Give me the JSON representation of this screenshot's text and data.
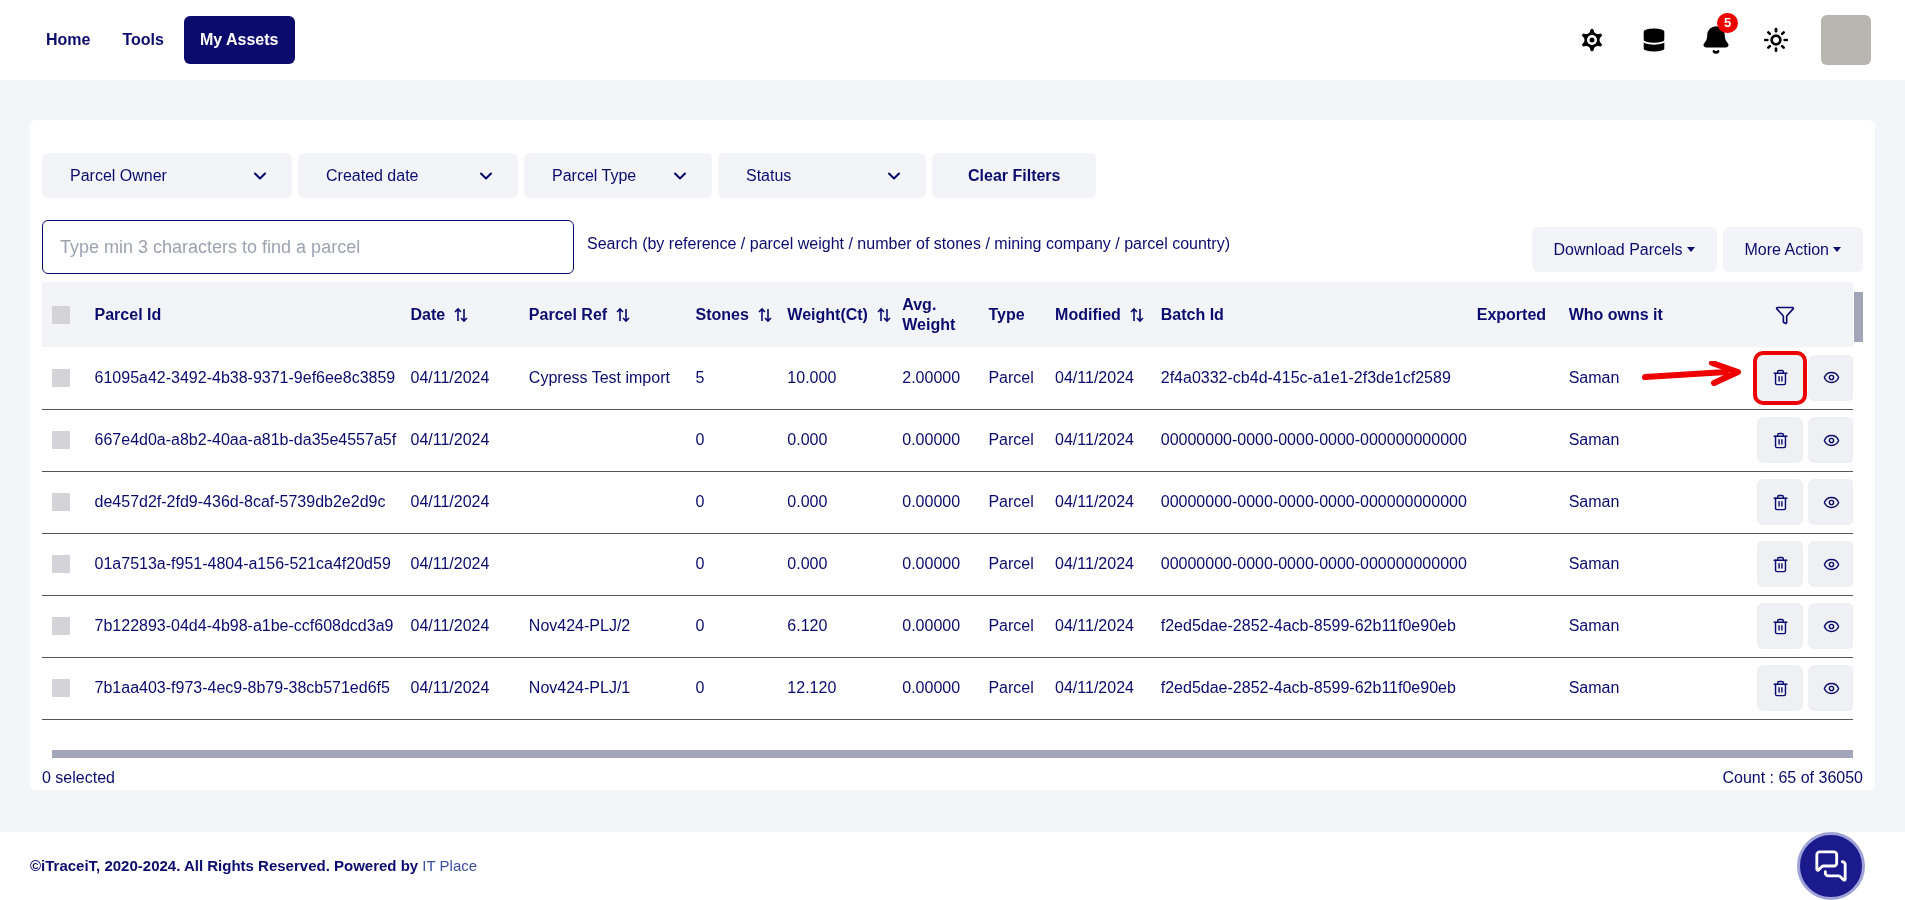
{
  "nav": {
    "tabs": [
      {
        "label": "Home",
        "selected": false
      },
      {
        "label": "Tools",
        "selected": false
      },
      {
        "label": "My Assets",
        "selected": true
      }
    ],
    "notification_count": "5"
  },
  "filters": [
    "Parcel Owner",
    "Created date",
    "Parcel Type",
    "Status"
  ],
  "clear_filters": "Clear Filters",
  "search": {
    "placeholder": "Type min 3 characters to find a parcel",
    "hint": "Search (by reference / parcel weight / number of stones / mining company / parcel country)"
  },
  "actions": [
    "Download Parcels",
    "More Action"
  ],
  "table": {
    "select_all_checked": false,
    "columns": [
      {
        "label": "Parcel Id",
        "sortable": false
      },
      {
        "label": "Date",
        "sortable": true
      },
      {
        "label": "Parcel Ref",
        "sortable": true
      },
      {
        "label": "Stones",
        "sortable": true
      },
      {
        "label": "Weight(Ct)",
        "sortable": true
      },
      {
        "label": "Avg. Weight",
        "sortable": false
      },
      {
        "label": "Type",
        "sortable": false
      },
      {
        "label": "Modified",
        "sortable": true
      },
      {
        "label": "Batch Id",
        "sortable": false
      },
      {
        "label": "Exported",
        "sortable": false
      },
      {
        "label": "Who owns it",
        "sortable": false
      }
    ],
    "rows": [
      {
        "checked": false,
        "annotated": true,
        "cells": [
          "61095a42-3492-4b38-9371-9ef6ee8c3859",
          "04/11/2024",
          "Cypress Test import",
          "5",
          "10.000",
          "2.00000",
          "Parcel",
          "04/11/2024",
          "2f4a0332-cb4d-415c-a1e1-2f3de1cf2589",
          "",
          "Saman"
        ]
      },
      {
        "checked": false,
        "annotated": false,
        "cells": [
          "667e4d0a-a8b2-40aa-a81b-da35e4557a5f",
          "04/11/2024",
          "",
          "0",
          "0.000",
          "0.00000",
          "Parcel",
          "04/11/2024",
          "00000000-0000-0000-0000-000000000000",
          "",
          "Saman"
        ]
      },
      {
        "checked": false,
        "annotated": false,
        "cells": [
          "de457d2f-2fd9-436d-8caf-5739db2e2d9c",
          "04/11/2024",
          "",
          "0",
          "0.000",
          "0.00000",
          "Parcel",
          "04/11/2024",
          "00000000-0000-0000-0000-000000000000",
          "",
          "Saman"
        ]
      },
      {
        "checked": false,
        "annotated": false,
        "cells": [
          "01a7513a-f951-4804-a156-521ca4f20d59",
          "04/11/2024",
          "",
          "0",
          "0.000",
          "0.00000",
          "Parcel",
          "04/11/2024",
          "00000000-0000-0000-0000-000000000000",
          "",
          "Saman"
        ]
      },
      {
        "checked": false,
        "annotated": false,
        "cells": [
          "7b122893-04d4-4b98-a1be-ccf608dcd3a9",
          "04/11/2024",
          "Nov424-PLJ/2",
          "0",
          "6.120",
          "0.00000",
          "Parcel",
          "04/11/2024",
          "f2ed5dae-2852-4acb-8599-62b11f0e90eb",
          "",
          "Saman"
        ]
      },
      {
        "checked": false,
        "annotated": false,
        "cells": [
          "7b1aa403-f973-4ec9-8b79-38cb571ed6f5",
          "04/11/2024",
          "Nov424-PLJ/1",
          "0",
          "12.120",
          "0.00000",
          "Parcel",
          "04/11/2024",
          "f2ed5dae-2852-4acb-8599-62b11f0e90eb",
          "",
          "Saman"
        ]
      }
    ]
  },
  "selected_count": "0 selected",
  "count": "Count : 65 of 36050",
  "footer": {
    "text": "©iTraceiT, 2020-2024. All Rights Reserved. Powered by",
    "link": "IT Place"
  }
}
